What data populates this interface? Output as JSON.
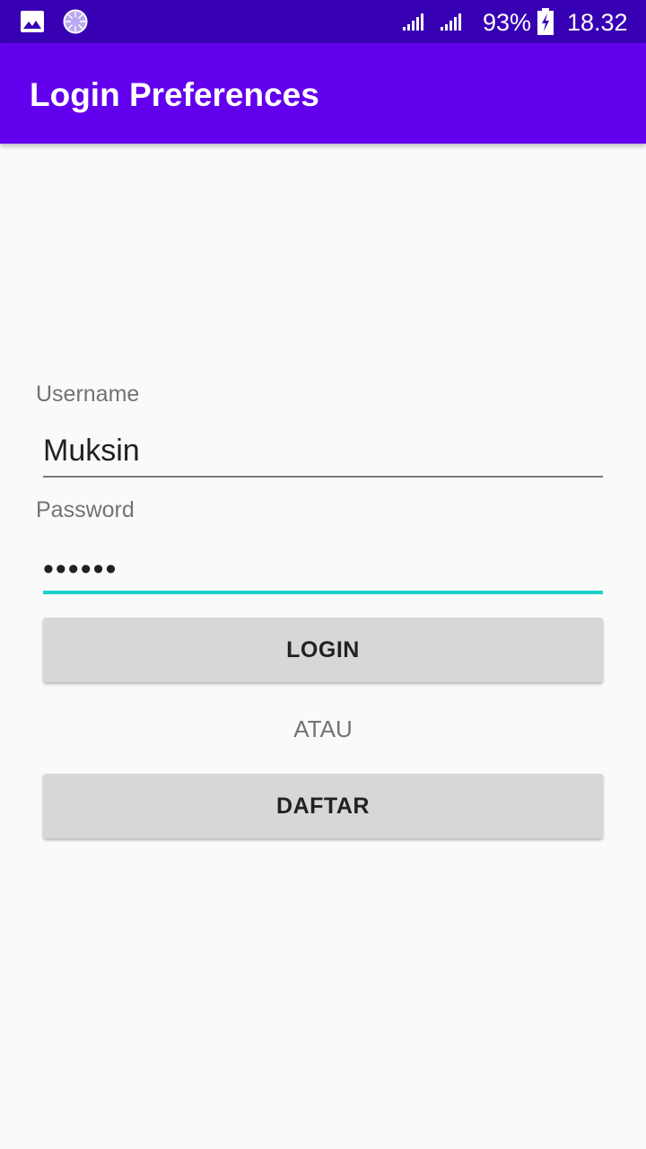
{
  "status_bar": {
    "icons": [
      "image-notification-icon",
      "sync-progress-icon",
      "signal-icon",
      "signal-icon",
      "battery-charging-icon"
    ],
    "battery_percent": "93%",
    "time": "18.32",
    "background": "#3700b3"
  },
  "app_bar": {
    "title": "Login Preferences",
    "background": "#6200ee"
  },
  "form": {
    "username_label": "Username",
    "username_value": "Muksin",
    "password_label": "Password",
    "password_value": "••••••",
    "login_button": "LOGIN",
    "separator": "ATAU",
    "register_button": "DAFTAR",
    "focus_color": "#1ad1c8",
    "button_color": "#d6d7d7"
  }
}
